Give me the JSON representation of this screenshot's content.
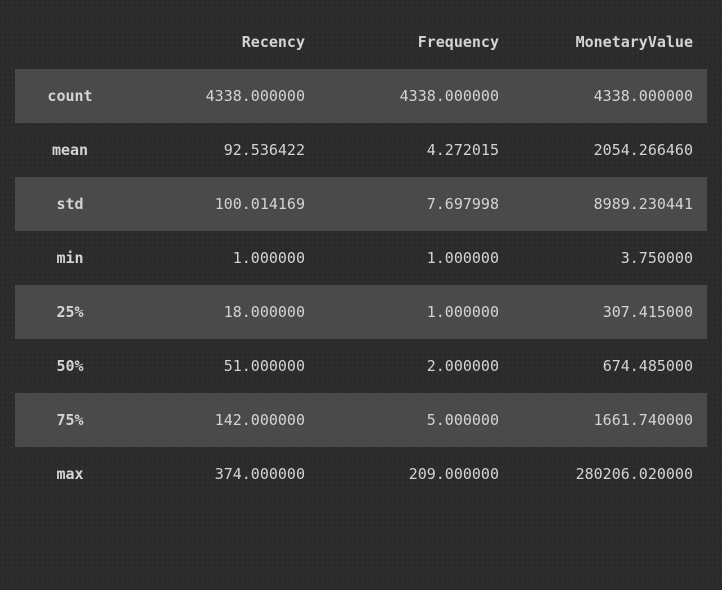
{
  "chart_data": {
    "type": "table",
    "title": "",
    "columns": [
      "Recency",
      "Frequency",
      "MonetaryValue"
    ],
    "index": [
      "count",
      "mean",
      "std",
      "min",
      "25%",
      "50%",
      "75%",
      "max"
    ],
    "rows": [
      [
        "4338.000000",
        "4338.000000",
        "4338.000000"
      ],
      [
        "92.536422",
        "4.272015",
        "2054.266460"
      ],
      [
        "100.014169",
        "7.697998",
        "8989.230441"
      ],
      [
        "1.000000",
        "1.000000",
        "3.750000"
      ],
      [
        "18.000000",
        "1.000000",
        "307.415000"
      ],
      [
        "51.000000",
        "2.000000",
        "674.485000"
      ],
      [
        "142.000000",
        "5.000000",
        "1661.740000"
      ],
      [
        "374.000000",
        "209.000000",
        "280206.020000"
      ]
    ]
  }
}
